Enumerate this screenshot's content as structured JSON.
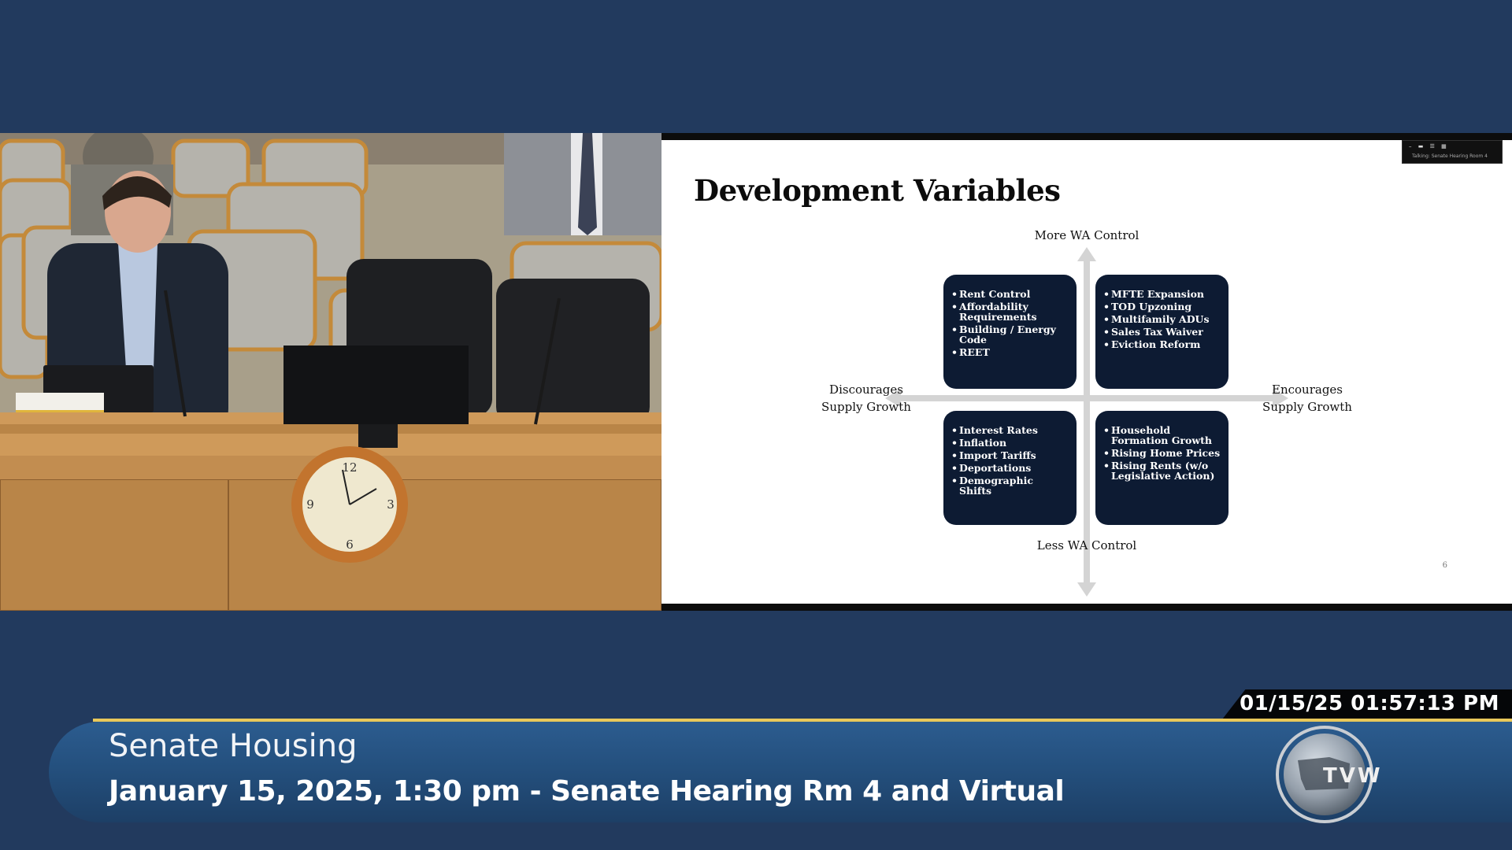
{
  "slide": {
    "title": "Development Variables",
    "axis_top": "More WA Control",
    "axis_bottom": "Less WA Control",
    "axis_left_line1": "Discourages",
    "axis_left_line2": "Supply Growth",
    "axis_right_line1": "Encourages",
    "axis_right_line2": "Supply Growth",
    "quadrants": {
      "top_left": [
        "Rent Control",
        "Affordability Requirements",
        "Building / Energy Code",
        "REET"
      ],
      "top_right": [
        "MFTE Expansion",
        "TOD Upzoning",
        "Multifamily ADUs",
        "Sales Tax Waiver",
        "Eviction Reform"
      ],
      "bottom_left": [
        "Interest Rates",
        "Inflation",
        "Import Tariffs",
        "Deportations",
        "Demographic Shifts"
      ],
      "bottom_right": [
        "Household Formation Growth",
        "Rising Home Prices",
        "Rising Rents (w/o Legislative Action)"
      ]
    },
    "page_number": "6",
    "overlay_caption": "Talking: Senate Hearing Room 4"
  },
  "broadcast": {
    "timestamp": "01/15/25 01:57:13 PM",
    "title": "Senate Housing",
    "subtitle": "January 15, 2025, 1:30 pm - Senate Hearing Rm 4 and Virtual",
    "logo_text": "TVW"
  },
  "colors": {
    "background": "#223a5e",
    "quadrant": "#0d1b33",
    "accent_line": "#e9c85a",
    "banner": "#24507e"
  }
}
